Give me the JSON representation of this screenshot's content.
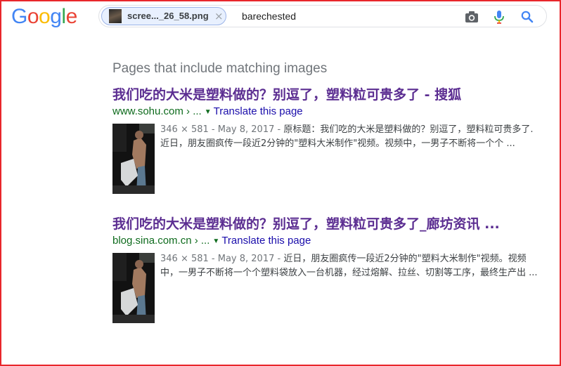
{
  "header": {
    "logo_letters": [
      "G",
      "o",
      "o",
      "g",
      "l",
      "e"
    ],
    "search": {
      "image_chip_label": "scree..._26_58.png",
      "image_chip_close": "×",
      "query": "barechested"
    },
    "icons": [
      "camera-icon",
      "microphone-icon",
      "search-icon"
    ]
  },
  "results_section": {
    "title": "Pages that include matching images",
    "results": [
      {
        "title": "我们吃的大米是塑料做的？别逗了，塑料粒可贵多了 - 搜狐",
        "url": "www.sohu.com › ...",
        "translate": "Translate this page",
        "meta": "346 × 581 - May 8, 2017 -",
        "snippet": " 原标题：我们吃的大米是塑料做的？别逗了，塑料粒可贵多了. 近日，朋友圈疯传一段近2分钟的\"塑料大米制作\"视频。视频中，一男子不断将一个个 ..."
      },
      {
        "title": "我们吃的大米是塑料做的？别逗了，塑料粒可贵多了_廊坊资讯 ...",
        "url": "blog.sina.com.cn › ...",
        "translate": "Translate this page",
        "meta": "346 × 581 - May 8, 2017 -",
        "snippet": " 近日，朋友圈疯传一段近2分钟的\"塑料大米制作\"视频。视频中，一男子不断将一个个塑料袋放入一台机器，经过熔解、拉丝、切割等工序，最终生产出 ..."
      }
    ]
  },
  "colors": {
    "frame_border": "#e8262b",
    "result_title": "#5b2d91",
    "result_url": "#0e6b1d",
    "translate_link": "#1a0dab",
    "logo": [
      "#4285f4",
      "#ea4335",
      "#fbbc05",
      "#4285f4",
      "#34a853",
      "#ea4335"
    ]
  }
}
